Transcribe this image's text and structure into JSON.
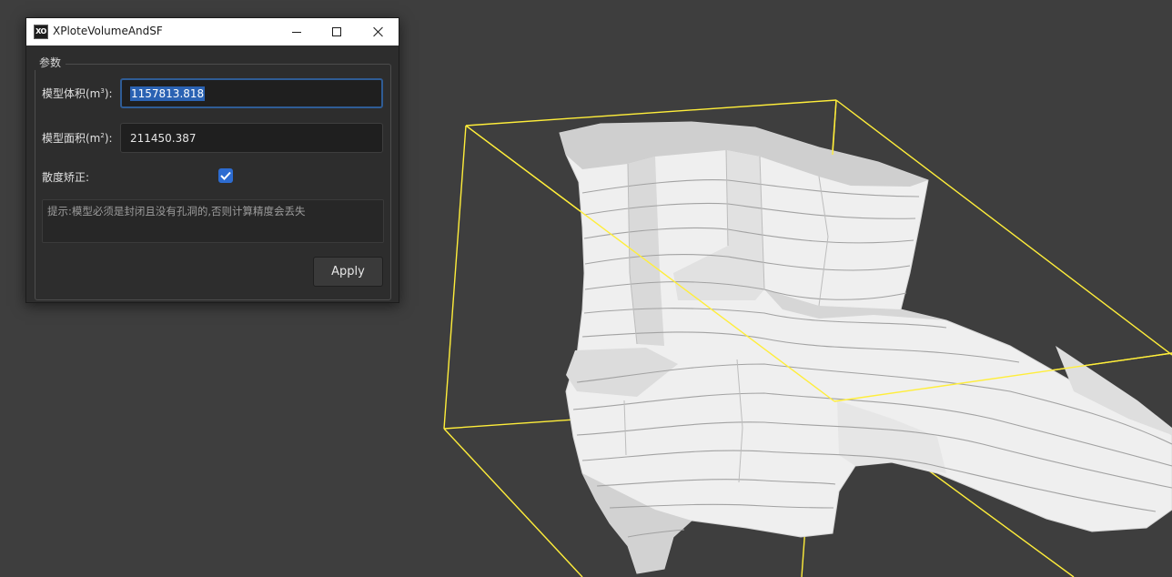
{
  "window": {
    "title": "XPloteVolumeAndSF",
    "icon_text": "XO",
    "controls": [
      "minimize-icon",
      "maximize-icon",
      "close-icon"
    ]
  },
  "group": {
    "title": "参数"
  },
  "volume": {
    "label": "模型体积(m",
    "label_sup": "3",
    "label_tail": "):",
    "value": "1157813.818"
  },
  "area": {
    "label": "模型面积(m",
    "label_sup": "2",
    "label_tail": "):",
    "value": "211450.387"
  },
  "correction": {
    "label": "散度矫正:",
    "checked": true
  },
  "hint": {
    "text": "提示:模型必须是封闭且没有孔洞的,否则计算精度会丢失"
  },
  "apply": {
    "label": "Apply"
  },
  "viewport": {
    "background": "#3e3e3e",
    "bbox_color": "#ffee3a",
    "model_color": "#f2f2f2"
  }
}
